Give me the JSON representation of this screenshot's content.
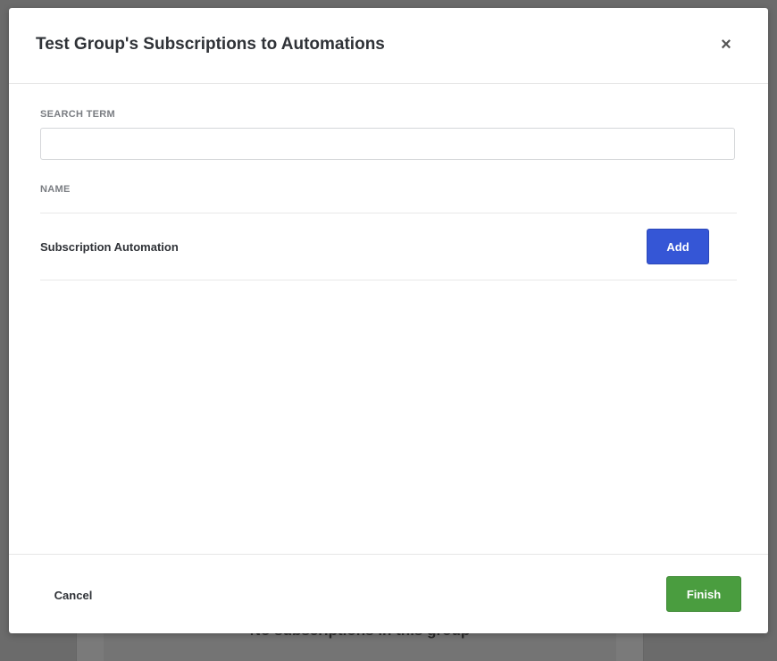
{
  "background": {
    "empty_state_text": "No subscriptions in this group"
  },
  "modal": {
    "title": "Test Group's Subscriptions to Automations",
    "close_icon": "close-icon",
    "close_glyph": "×",
    "search": {
      "label": "SEARCH TERM",
      "value": "",
      "placeholder": ""
    },
    "table": {
      "column_header": "NAME",
      "rows": [
        {
          "name": "Subscription Automation",
          "action_label": "Add"
        }
      ]
    },
    "footer": {
      "cancel_label": "Cancel",
      "finish_label": "Finish"
    }
  },
  "colors": {
    "add_button": "#3556d6",
    "finish_button": "#4a9d3f",
    "overlay": "#6b6b6b"
  }
}
